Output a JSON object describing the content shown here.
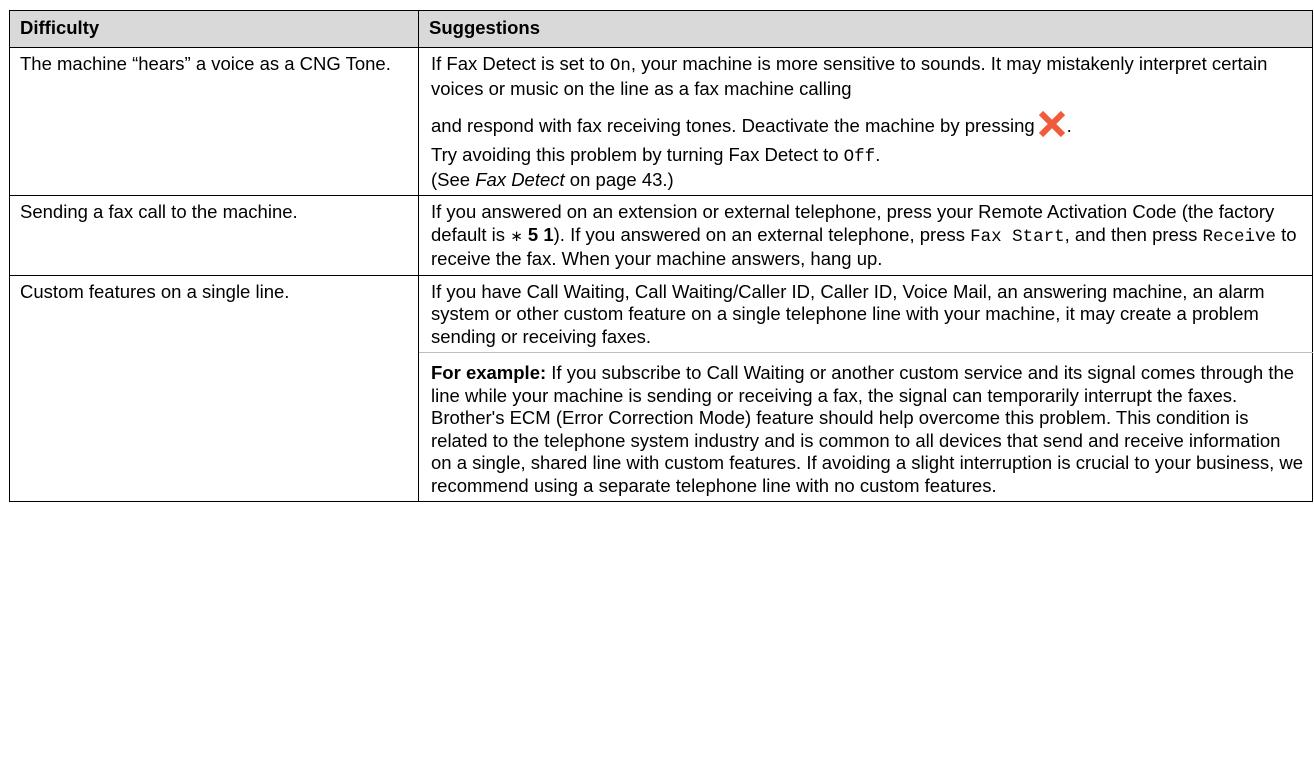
{
  "table": {
    "headers": {
      "difficulty": "Difficulty",
      "suggestions": "Suggestions"
    },
    "row1": {
      "difficulty": "The machine “hears” a voice as a CNG Tone.",
      "s1_a": "If Fax Detect is set to ",
      "s1_on": "On",
      "s1_b": ", your machine is more sensitive to sounds. It may mistakenly interpret certain voices or music on the line as a fax machine calling",
      "s2": "and respond with fax receiving tones. Deactivate the machine by pressing",
      "s2_end": ".",
      "s3_a": "Try avoiding this problem by turning Fax Detect to ",
      "s3_off": "Off",
      "s3_end": ".",
      "s4_a": "(See ",
      "s4_ref": "Fax Detect",
      "s4_b": " on page 43.)",
      "stop_icon": "stop-x-icon",
      "stop_icon_color": "#f15a3a"
    },
    "row2": {
      "difficulty": "Sending a fax call to the machine.",
      "t1": "If you answered on an extension or external telephone, press your Remote Activation Code (the factory default is ",
      "star": "∗",
      "code": " 5 1",
      "t2": "). If you answered on an external telephone, press ",
      "fax_start": "Fax Start",
      "t3": ", and then press ",
      "receive": "Receive",
      "t4": " to receive the fax. When your machine answers, hang up."
    },
    "row3": {
      "difficulty": "Custom features on a single line.",
      "p1": "If you have Call Waiting, Call Waiting/Caller ID, Caller ID, Voice Mail, an answering machine, an alarm system or other custom feature on a single telephone line with your machine, it may create a problem sending or receiving faxes.",
      "example_label": "For example:",
      "p2": " If you subscribe to Call Waiting or another custom service and its signal comes through the line while your machine is sending or receiving a fax, the signal can temporarily interrupt the faxes. Brother's ECM (Error Correction Mode) feature should help overcome this problem. This condition is related to the telephone system industry and is common to all devices that send and receive information on a single, shared line with custom features. If avoiding a slight interruption is crucial to your business, we recommend using a separate telephone line with no custom features."
    }
  }
}
